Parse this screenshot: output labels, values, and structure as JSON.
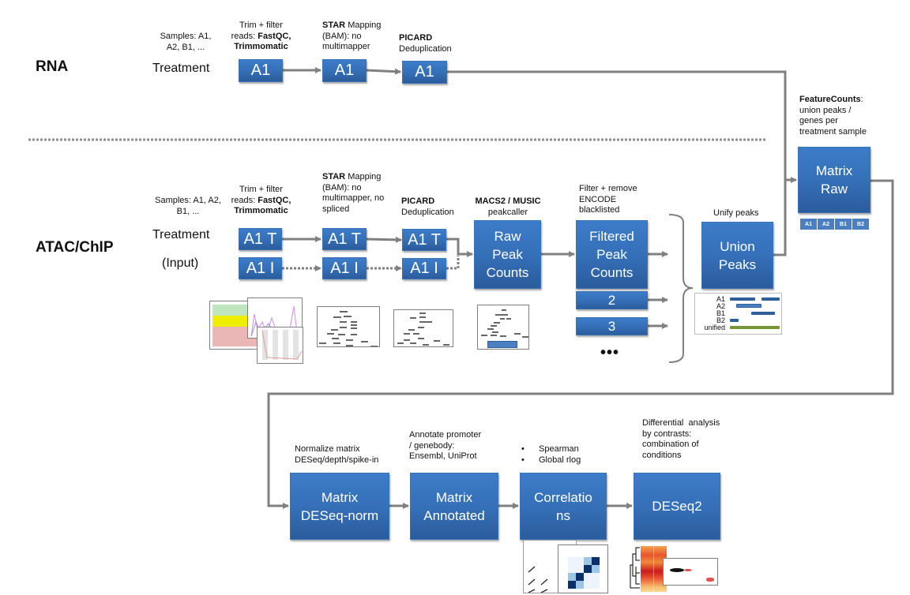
{
  "rna": {
    "row_label": "RNA",
    "samples_note": [
      "Samples: A1,",
      "A2, B1, ..."
    ],
    "treatment_label": "Treatment",
    "steps": [
      {
        "note_bold": "",
        "note_lines": [
          "Trim + filter",
          "reads: FastQC,",
          "Trimmomatic"
        ],
        "box": "A1"
      },
      {
        "note_lines": [
          "STAR Mapping",
          "(BAM): no",
          "multimapper"
        ],
        "box": "A1"
      },
      {
        "note_lines": [
          "PICARD",
          "Deduplication"
        ],
        "box": "A1"
      }
    ]
  },
  "atac": {
    "row_label": "ATAC/ChIP",
    "samples_note": [
      "Samples: A1, A2,",
      "B1, ..."
    ],
    "treatment_label": "Treatment",
    "input_label": "(Input)",
    "trim_note": [
      "Trim + filter",
      "reads: FastQC,",
      "Trimmomatic"
    ],
    "star_note": [
      "STAR Mapping",
      "(BAM): no",
      "multimapper, no",
      "spliced"
    ],
    "picard_note": [
      "PICARD",
      "Deduplication"
    ],
    "macs_note": [
      "MACS2 / MUSIC",
      "peakcaller"
    ],
    "filter_note": [
      "Filter + remove",
      "ENCODE",
      "blacklisted"
    ],
    "unify_note": "Unify peaks",
    "treatment_boxes": [
      "A1 T",
      "A1 T",
      "A1 T"
    ],
    "input_boxes": [
      "A1 I",
      "A1 I",
      "A1 I"
    ],
    "raw_peak_box": [
      "Raw",
      "Peak",
      "Counts"
    ],
    "filtered_peak_box": [
      "Filtered",
      "Peak",
      "Counts"
    ],
    "extra_boxes": [
      "2",
      "3"
    ],
    "ellipsis": "•••",
    "union_box": [
      "Union",
      "Peaks"
    ],
    "union_legend": [
      {
        "label": "A1"
      },
      {
        "label": "A2"
      },
      {
        "label": "B1"
      },
      {
        "label": "B2"
      },
      {
        "label": "unified"
      }
    ]
  },
  "feature_counts": {
    "note_bold": "FeatureCounts",
    "note_lines": [
      ":",
      "union peaks /",
      "genes per",
      "treatment sample"
    ],
    "matrix_box": [
      "Matrix",
      "Raw"
    ],
    "sample_tags": [
      "A1",
      "A2",
      "B1",
      "B2"
    ]
  },
  "downstream": {
    "normalize_note": [
      "Normalize matrix",
      "DESeq/depth/spike-in"
    ],
    "annotate_note": [
      "Annotate promoter",
      "/ genebody:",
      "Ensembl, UniProt"
    ],
    "correlation_note": [
      "Spearman",
      "Global rlog"
    ],
    "differential_note": [
      "Differential  analysis",
      "by contrasts:",
      "combination of",
      "conditions"
    ],
    "boxes": [
      [
        "Matrix",
        "DESeq-norm"
      ],
      [
        "Matrix",
        "Annotated"
      ],
      [
        "Correlatio",
        "ns"
      ],
      [
        "DESeq2"
      ]
    ]
  },
  "colors": {
    "box_blue": "#3570b8",
    "arrow_gray": "#7f7f7f",
    "unified_green": "#77963a",
    "legend_bar_blue": "#2f5f99"
  }
}
